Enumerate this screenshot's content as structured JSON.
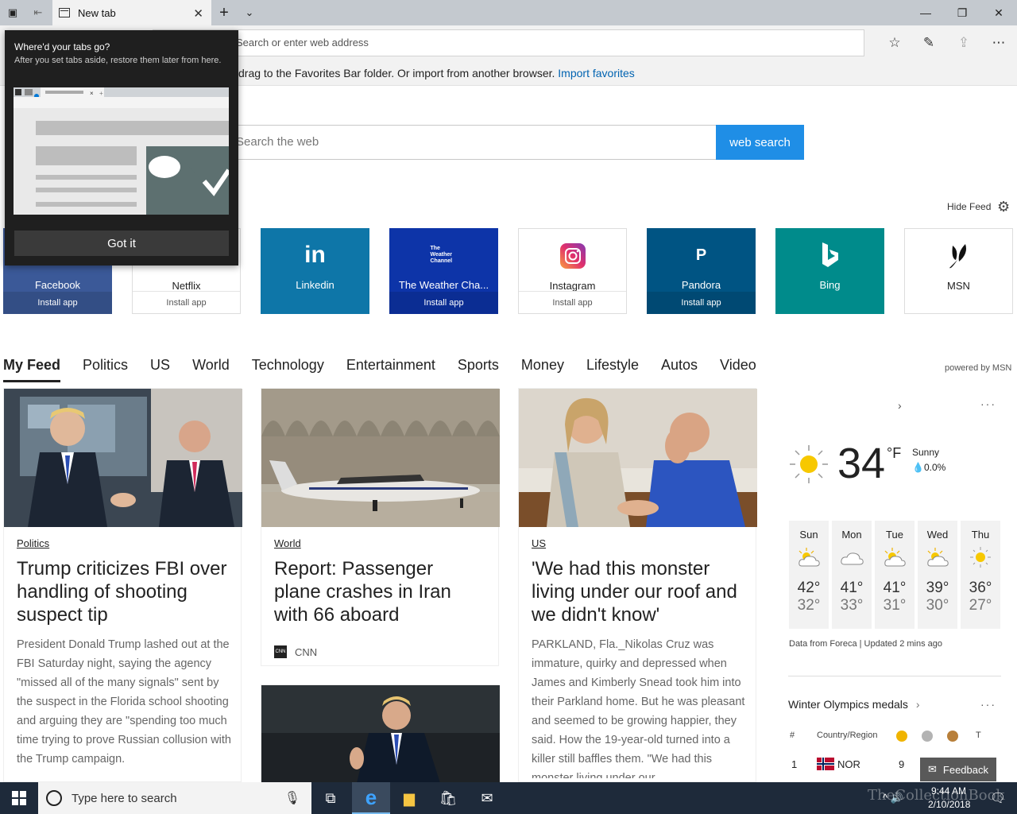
{
  "window": {
    "tab_title": "New tab"
  },
  "address_bar": {
    "placeholder": "Search or enter web address"
  },
  "favorites_hint": {
    "text": "drag to the Favorites Bar folder. Or import from another browser.",
    "link": "Import favorites"
  },
  "search": {
    "placeholder": "Search the web",
    "button": "web search"
  },
  "hide_feed": "Hide Feed",
  "popup": {
    "title": "Where'd your tabs go?",
    "body": "After you set tabs aside, restore them later from here.",
    "button": "Got it"
  },
  "tiles": [
    {
      "name": "Facebook",
      "install": "Install app",
      "bg": "#3b5998",
      "fg": "#ffffff",
      "icon": "facebook-icon"
    },
    {
      "name": "Netflix",
      "install": "Install app",
      "bg": "#ffffff",
      "fg": "#222222",
      "icon": "netflix-icon"
    },
    {
      "name": "Linkedin",
      "install": "",
      "bg": "#0e76a8",
      "fg": "#ffffff",
      "icon": "linkedin-icon",
      "glyph": "in"
    },
    {
      "name": "The Weather Cha...",
      "install": "Install app",
      "bg": "#0d34a8",
      "fg": "#ffffff",
      "icon": "weather-channel-icon",
      "glyph": "The Weather Channel"
    },
    {
      "name": "Instagram",
      "install": "Install app",
      "bg": "#ffffff",
      "fg": "#222222",
      "icon": "instagram-icon"
    },
    {
      "name": "Pandora",
      "install": "Install app",
      "bg": "#005483",
      "fg": "#ffffff",
      "icon": "pandora-icon",
      "glyph": "P"
    },
    {
      "name": "Bing",
      "install": "",
      "bg": "#008b8b",
      "fg": "#ffffff",
      "icon": "bing-icon",
      "glyph": "b"
    },
    {
      "name": "MSN",
      "install": "",
      "bg": "#ffffff",
      "fg": "#222222",
      "icon": "msn-icon"
    }
  ],
  "feed_nav": [
    "My Feed",
    "Politics",
    "US",
    "World",
    "Technology",
    "Entertainment",
    "Sports",
    "Money",
    "Lifestyle",
    "Autos",
    "Video"
  ],
  "powered_by": "powered by MSN",
  "cards": [
    {
      "category": "Politics",
      "headline": "Trump criticizes FBI over handling of shooting suspect tip",
      "body": "President Donald Trump lashed out at the FBI Saturday night, saying the agency \"missed all of the many signals\" sent by the suspect in the Florida school shooting and arguing they are \"spending too much time trying to prove Russian collusion with the Trump campaign."
    },
    {
      "category": "World",
      "headline": "Report: Passenger plane crashes in Iran with 66 aboard",
      "source": "CNN"
    },
    {
      "category": "US",
      "headline": "'We had this monster living under our roof and we didn't know'",
      "body": "PARKLAND, Fla._Nikolas Cruz was immature, quirky and depressed when James and Kimberly Snead took him into their Parkland home. But he was pleasant and seemed to be growing happier, they said. How the 19-year-old turned into a killer still baffles them. \"We had this monster living under our"
    }
  ],
  "weather": {
    "temp": "34",
    "unit": "°F",
    "condition": "Sunny",
    "precip": "0.0%",
    "days": [
      {
        "day": "Sun",
        "hi": "42°",
        "lo": "32°",
        "icon": "partly-sunny-icon"
      },
      {
        "day": "Mon",
        "hi": "41°",
        "lo": "33°",
        "icon": "cloudy-icon"
      },
      {
        "day": "Tue",
        "hi": "41°",
        "lo": "31°",
        "icon": "partly-sunny-icon"
      },
      {
        "day": "Wed",
        "hi": "39°",
        "lo": "30°",
        "icon": "partly-sunny-icon"
      },
      {
        "day": "Thu",
        "hi": "36°",
        "lo": "27°",
        "icon": "sunny-icon"
      }
    ],
    "footer": "Data from Foreca | Updated 2 mins ago"
  },
  "olympics": {
    "title": "Winter Olympics medals",
    "col_num": "#",
    "col_country": "Country/Region",
    "col_total": "T",
    "row": {
      "rank": "1",
      "country": "NOR",
      "gold": "9"
    }
  },
  "feedback": "Feedback",
  "taskbar": {
    "search_placeholder": "Type here to search",
    "time": "9:44 AM",
    "date": "2/10/2018"
  },
  "watermark": "TheCollectionBook"
}
